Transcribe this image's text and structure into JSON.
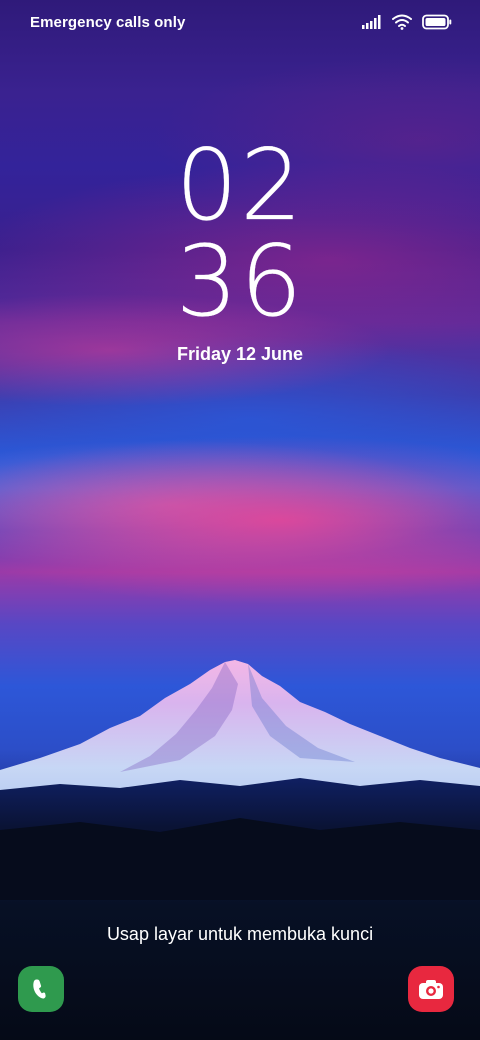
{
  "status_bar": {
    "carrier_text": "Emergency calls only",
    "icons": [
      "signal-icon",
      "wifi-icon",
      "battery-icon"
    ]
  },
  "lock_screen": {
    "clock_hour": "02",
    "clock_minute": "36",
    "date": "Friday 12 June",
    "unlock_hint": "Usap layar untuk membuka kunci"
  },
  "shortcuts": {
    "left": {
      "icon": "phone-icon",
      "color": "#2f9a4e"
    },
    "right": {
      "icon": "camera-icon",
      "color": "#e8283f"
    }
  },
  "colors": {
    "sky_top": "#2f1a7a",
    "sky_pink_band": "#e24696",
    "sky_blue": "#2f62df",
    "ground": "#050a17",
    "text": "#ffffff"
  }
}
